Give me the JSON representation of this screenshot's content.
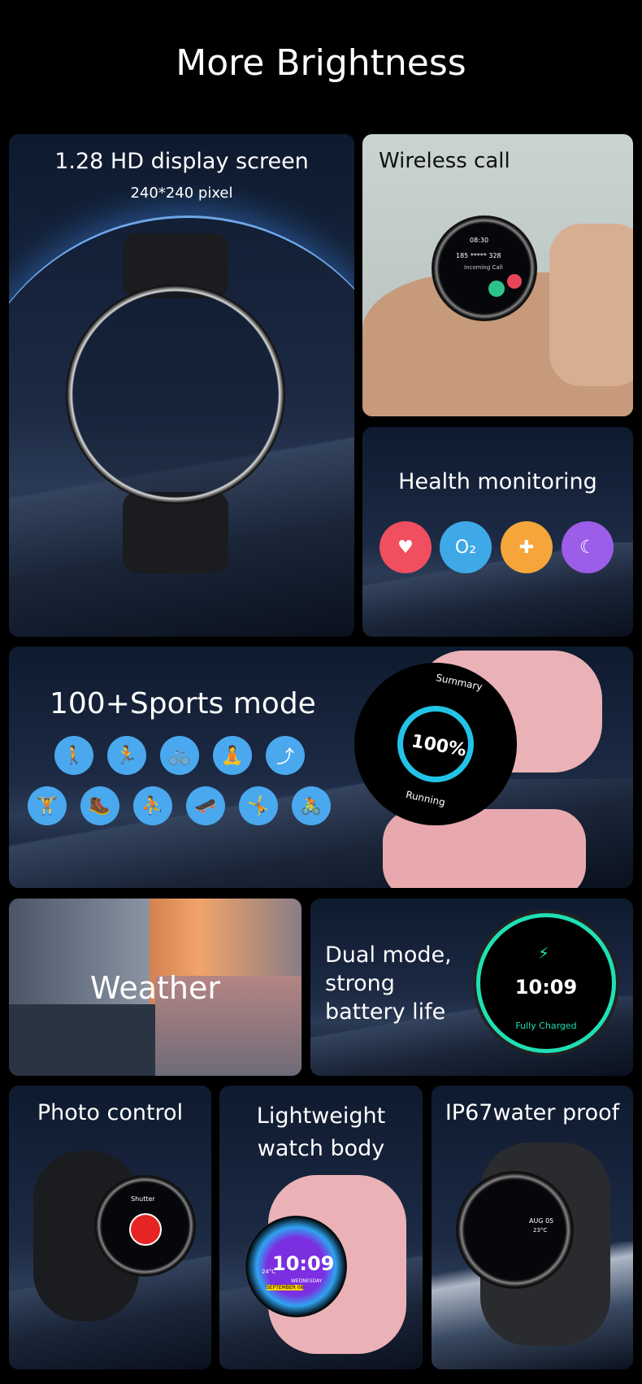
{
  "header": {
    "title": "More Brightness"
  },
  "display": {
    "title": "1.28 HD display screen",
    "subtitle": "240*240 pixel"
  },
  "call": {
    "title": "Wireless call",
    "time": "08:30",
    "number": "185 ***** 328",
    "status": "Incoming Call"
  },
  "health": {
    "title": "Health monitoring",
    "icons": [
      {
        "name": "heart-rate-icon",
        "color": "#ef4f5f"
      },
      {
        "name": "blood-oxygen-icon",
        "color": "#3fa9e8"
      },
      {
        "name": "blood-pressure-icon",
        "color": "#f6a53a"
      },
      {
        "name": "sleep-icon",
        "color": "#9c5ee8"
      }
    ]
  },
  "sports": {
    "title": "100+Sports mode",
    "screen_header": "Summary",
    "percent": "100%",
    "activity": "Running",
    "icons": [
      "walking",
      "running",
      "cycling",
      "yoga",
      "jump-rope",
      "weightlifting",
      "hiking",
      "basketball",
      "skateboarding",
      "stretching",
      "elliptical"
    ]
  },
  "weather": {
    "title": "Weather"
  },
  "battery": {
    "title_lines": [
      "Dual mode,",
      "strong",
      "battery life"
    ],
    "time": "10:09",
    "status": "Fully Charged",
    "accent": "#1ee0b4"
  },
  "photo": {
    "title": "Photo control",
    "screen_label": "Shutter"
  },
  "light": {
    "title_lines": [
      "Lightweight",
      "watch body"
    ],
    "time": "10:09",
    "day": "WEDNESDAY",
    "date": "SEPTEMBER 08",
    "temp": "24°C"
  },
  "water": {
    "title": "IP67water proof",
    "date": "AUG 05",
    "temp": "23°C"
  }
}
